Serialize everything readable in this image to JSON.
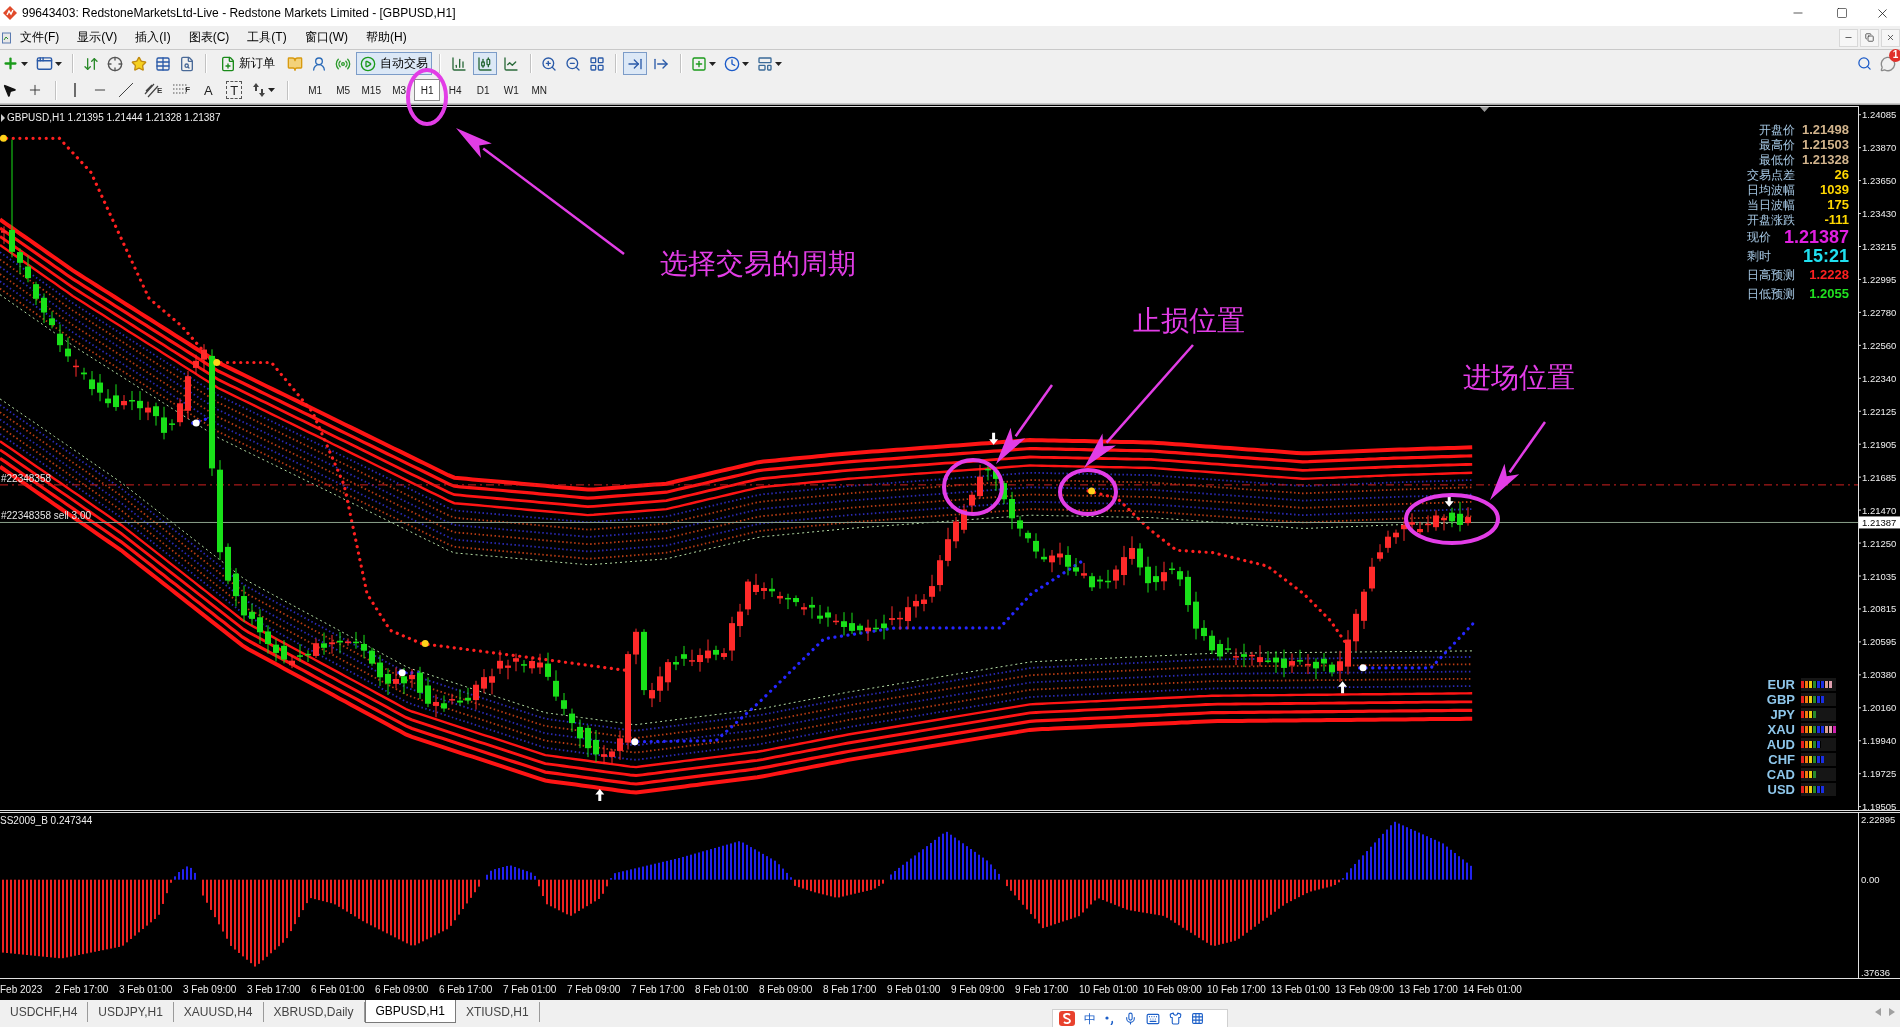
{
  "window": {
    "title": "99643403: RedstoneMarketsLtd-Live - Redstone Markets Limited - [GBPUSD,H1]"
  },
  "menu": [
    "文件(F)",
    "显示(V)",
    "插入(I)",
    "图表(C)",
    "工具(T)",
    "窗口(W)",
    "帮助(H)"
  ],
  "toolbar": {
    "new_order": "新订单",
    "auto_trading": {
      "label": "自动交易",
      "on": true
    },
    "chart_types": [
      {
        "selected": false
      },
      {
        "selected": true
      },
      {
        "selected": false
      }
    ],
    "auto_scroll": true,
    "chart_shift": false,
    "notifications": "1"
  },
  "drawing_tools": {
    "channel_mark": "E",
    "fibo_mark": "F",
    "text_tool": "A",
    "label_tool": "T"
  },
  "timeframes": [
    {
      "label": "M1",
      "selected": false
    },
    {
      "label": "M5",
      "selected": false
    },
    {
      "label": "M15",
      "selected": false
    },
    {
      "label": "M3",
      "selected": false
    },
    {
      "label": "H1",
      "selected": true
    },
    {
      "label": "H4",
      "selected": false
    },
    {
      "label": "D1",
      "selected": false
    },
    {
      "label": "W1",
      "selected": false
    },
    {
      "label": "MN",
      "selected": false
    }
  ],
  "chart": {
    "symbol_info": "GBPUSD,H1 1.21395 1.21444 1.21328 1.21387",
    "order_labels": [
      "#22348358",
      "#22348358 sell 3.00"
    ],
    "price_ticks": [
      "1.24085",
      "1.23870",
      "1.23650",
      "1.23430",
      "1.23215",
      "1.22995",
      "1.22780",
      "1.22560",
      "1.22340",
      "1.22125",
      "1.21905",
      "1.21685",
      "1.21470",
      "1.21250",
      "1.21035",
      "1.20815",
      "1.20595",
      "1.20380",
      "1.20160",
      "1.19940",
      "1.19725",
      "1.19505"
    ],
    "current_price": "1.21387",
    "quote_panel": [
      {
        "label": "开盘价",
        "value": "1.21498",
        "color": "#d2b48c",
        "kind": "small"
      },
      {
        "label": "最高价",
        "value": "1.21503",
        "color": "#d2b48c",
        "kind": "small"
      },
      {
        "label": "最低价",
        "value": "1.21328",
        "color": "#d2b48c",
        "kind": "small"
      },
      {
        "label": "交易点差",
        "value": "26",
        "color": "#ffd700",
        "kind": "small"
      },
      {
        "label": "日均波幅",
        "value": "1039",
        "color": "#ffd700",
        "kind": "small"
      },
      {
        "label": "当日波幅",
        "value": "175",
        "color": "#ffd700",
        "kind": "small"
      },
      {
        "label": "开盘涨跌",
        "value": "-111",
        "color": "#ffd700",
        "kind": "small"
      },
      {
        "label": "现价",
        "value": "1.21387",
        "color": "#e020e0",
        "kind": "quote"
      },
      {
        "label": "剩时",
        "value": "15:21",
        "color": "#20e0f0",
        "kind": "quote"
      },
      {
        "label": "日高预测",
        "value": "1.2228",
        "color": "#ff2020",
        "kind": "forecast"
      },
      {
        "label": "日低预测",
        "value": "1.2055",
        "color": "#20e020",
        "kind": "forecast"
      }
    ],
    "currency_strength": [
      {
        "code": "EUR",
        "level": 0.89
      },
      {
        "code": "GBP",
        "level": 0.67
      },
      {
        "code": "JPY",
        "level": 0.44
      },
      {
        "code": "XAU",
        "level": 1
      },
      {
        "code": "AUD",
        "level": 0.56
      },
      {
        "code": "CHF",
        "level": 0.67
      },
      {
        "code": "CAD",
        "level": 0.44
      },
      {
        "code": "USD",
        "level": 0.67
      }
    ]
  },
  "indicator": {
    "label": "SS2009_B 0.247344",
    "ticks": [
      "2.22895",
      "0.00",
      ".37636"
    ]
  },
  "time_axis": [
    "Feb 2023",
    "2 Feb 17:00",
    "3 Feb 01:00",
    "3 Feb 09:00",
    "3 Feb 17:00",
    "6 Feb 01:00",
    "6 Feb 09:00",
    "6 Feb 17:00",
    "7 Feb 01:00",
    "7 Feb 09:00",
    "7 Feb 17:00",
    "8 Feb 01:00",
    "8 Feb 09:00",
    "8 Feb 17:00",
    "9 Feb 01:00",
    "9 Feb 09:00",
    "9 Feb 17:00",
    "10 Feb 01:00",
    "10 Feb 09:00",
    "10 Feb 17:00",
    "13 Feb 01:00",
    "13 Feb 09:00",
    "13 Feb 17:00",
    "14 Feb 01:00"
  ],
  "tabs": [
    {
      "label": "USDCHF,H4",
      "selected": false
    },
    {
      "label": "USDJPY,H1",
      "selected": false
    },
    {
      "label": "XAUUSD,H4",
      "selected": false
    },
    {
      "label": "XBRUSD,Daily",
      "selected": false
    },
    {
      "label": "GBPUSD,H1",
      "selected": true
    },
    {
      "label": "XTIUSD,H1",
      "selected": false
    }
  ],
  "ime_bar": {
    "mode": "中"
  },
  "annotations": [
    "选择交易的周期",
    "止损位置",
    "进场位置"
  ]
}
